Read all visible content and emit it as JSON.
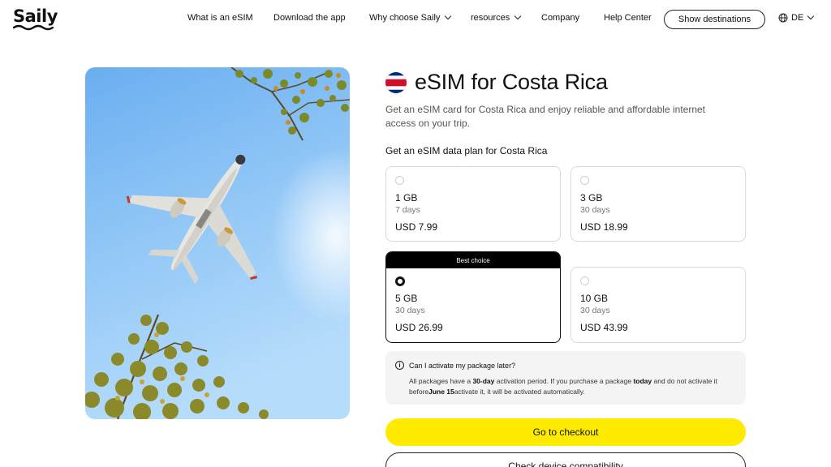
{
  "brand": {
    "name": "Saily"
  },
  "nav": {
    "items": [
      {
        "label": "What is an eSIM",
        "has_dropdown": false
      },
      {
        "label": "Download the app",
        "has_dropdown": false
      },
      {
        "label": "Why choose Saily",
        "has_dropdown": true
      },
      {
        "label": "resources",
        "has_dropdown": true
      },
      {
        "label": "Company",
        "has_dropdown": false
      },
      {
        "label": "Help Center",
        "has_dropdown": false
      }
    ],
    "cta_label": "Show destinations",
    "language": "DE",
    "language_icon": "globe-icon"
  },
  "hero_image": {
    "subject": "airplane-in-blue-sky"
  },
  "product": {
    "title": "eSIM for Costa Rica",
    "flag_colors": [
      "#002B7F",
      "#FFFFFF",
      "#CE1126"
    ],
    "subtitle": "Get an eSIM card for Costa Rica and enjoy reliable and affordable internet access on your trip.",
    "plans_heading": "Get an eSIM data plan for Costa Rica"
  },
  "plans": [
    {
      "data": "1 GB",
      "duration": "7 days",
      "price": "USD 7.99",
      "selected": false,
      "badge": ""
    },
    {
      "data": "3 GB",
      "duration": "30 days",
      "price": "USD 18.99",
      "selected": false,
      "badge": ""
    },
    {
      "data": "5 GB",
      "duration": "30 days",
      "price": "USD 26.99",
      "selected": true,
      "badge": "Best choice"
    },
    {
      "data": "10 GB",
      "duration": "30 days",
      "price": "USD 43.99",
      "selected": false,
      "badge": ""
    }
  ],
  "faq": {
    "question": "Can I activate my package later?",
    "answer_parts": {
      "p1": "All packages have a ",
      "b1": "30-day",
      "p2": " activation period. If you purchase a package ",
      "b2": "today",
      "p3": " and do not activate it before",
      "b3": "June 15",
      "p4": "activate it, it will be activated automatically."
    }
  },
  "actions": {
    "checkout_label": "Go to checkout",
    "compat_label": "Check device compatibility"
  },
  "colors": {
    "accent_yellow": "#FFEB00",
    "text_primary": "#111111",
    "faq_bg": "#F4F4F4"
  }
}
